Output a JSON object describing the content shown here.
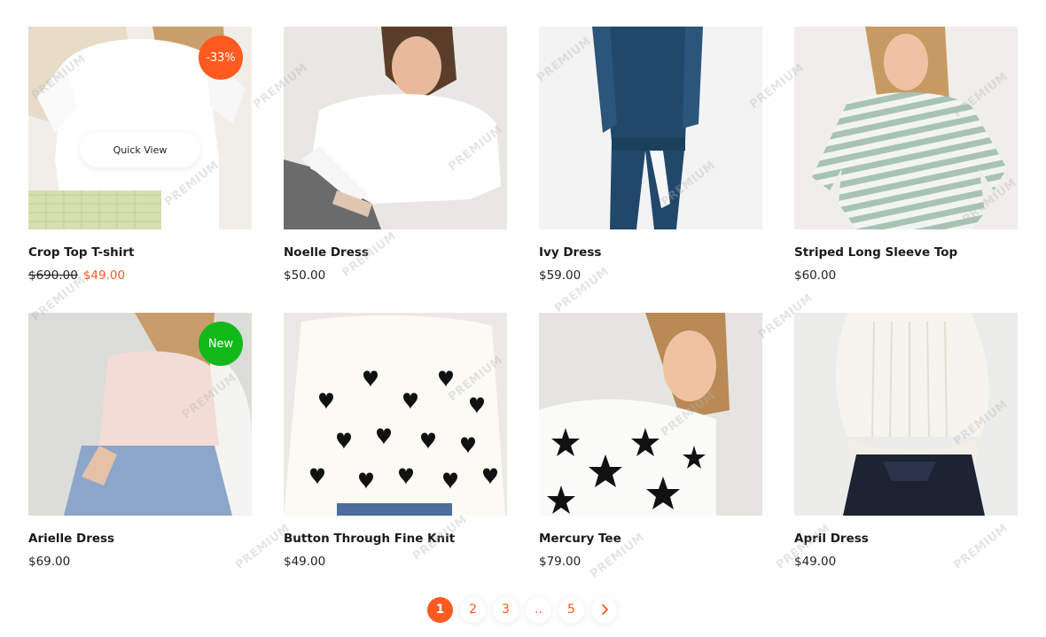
{
  "products": [
    {
      "title": "Crop Top T-shirt",
      "old_price": "$690.00",
      "price": "$49.00",
      "on_sale": true,
      "badge": "-33%",
      "badge_type": "sale",
      "quick_view": "Quick View",
      "image_icon": "crop-top-photo"
    },
    {
      "title": "Noelle Dress",
      "price": "$50.00",
      "image_icon": "white-top-photo"
    },
    {
      "title": "Ivy Dress",
      "price": "$59.00",
      "image_icon": "blue-jumpsuit-photo"
    },
    {
      "title": "Striped Long Sleeve Top",
      "price": "$60.00",
      "image_icon": "striped-top-photo"
    },
    {
      "title": "Arielle Dress",
      "price": "$69.00",
      "badge": "New",
      "badge_type": "new",
      "image_icon": "pink-tee-photo"
    },
    {
      "title": "Button Through Fine Knit",
      "price": "$49.00",
      "image_icon": "heart-knit-photo"
    },
    {
      "title": "Mercury Tee",
      "price": "$79.00",
      "image_icon": "star-tee-photo"
    },
    {
      "title": "April Dress",
      "price": "$49.00",
      "image_icon": "ribbed-knit-photo"
    }
  ],
  "pagination": {
    "pages": [
      "1",
      "2",
      "3",
      "..",
      "5"
    ],
    "current": "1",
    "next_icon": "chevron-right-icon"
  },
  "watermark": "PREMIUM",
  "colors": {
    "accent": "#ff5a1f",
    "new_badge": "#12b81a",
    "text": "#1a1a1a"
  }
}
